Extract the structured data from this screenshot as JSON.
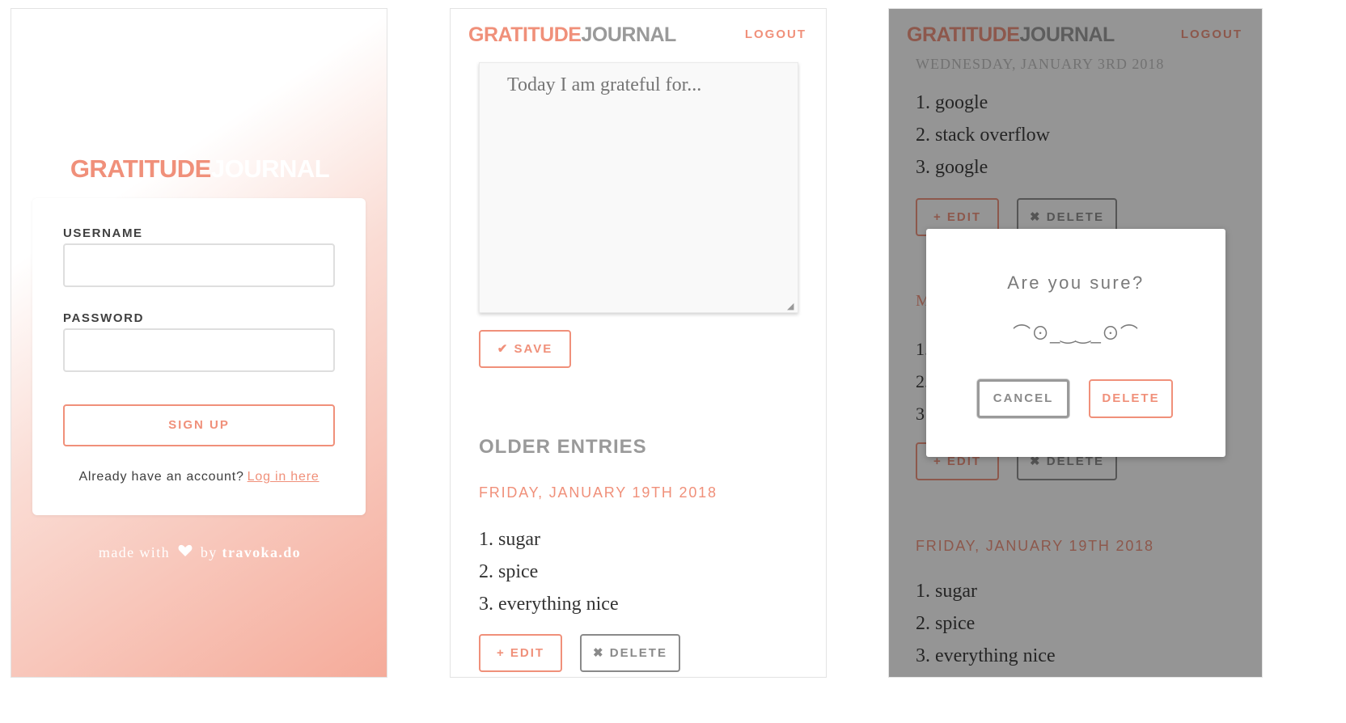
{
  "app": {
    "brand_part1": "GRATITUDE",
    "brand_part2": "JOURNAL"
  },
  "login": {
    "username_label": "USERNAME",
    "password_label": "PASSWORD",
    "signup_label": "SIGN UP",
    "account_prompt": "Already have an account?",
    "login_link": "Log in here",
    "footer_made_with": "made with",
    "footer_heart": "heart-icon",
    "footer_by": "by",
    "footer_author": "travoka.do"
  },
  "header": {
    "logout_label": "LOGOUT"
  },
  "journal": {
    "textarea_placeholder": "Today I am grateful for...",
    "save_icon": "✔",
    "save_label": "SAVE",
    "older_entries_title": "OLDER ENTRIES",
    "entry": {
      "date": "FRIDAY, JANUARY 19TH 2018",
      "items": [
        "1. sugar",
        "2. spice",
        "3. everything nice"
      ]
    },
    "edit_icon": "+",
    "edit_label": "EDIT",
    "delete_icon": "✖",
    "delete_label": "DELETE"
  },
  "confirm_view": {
    "top_entry_partial_date": "WEDNESDAY, JANUARY 3RD 2018",
    "top_entry_items": [
      "1. google",
      "2. stack overflow",
      "3. google"
    ],
    "middle_partial_letters": [
      "M",
      "1.",
      "2.",
      "3"
    ],
    "bottom_entry": {
      "date": "FRIDAY, JANUARY 19TH 2018",
      "items": [
        "1. sugar",
        "2. spice",
        "3. everything nice"
      ]
    },
    "modal": {
      "title": "Are you sure?",
      "face": "⌒⊙_‿‿_⊙⌒",
      "cancel_label": "CANCEL",
      "delete_label": "DELETE"
    }
  },
  "colors": {
    "accent": "#f0907a",
    "muted": "#9a9a9a",
    "overlay": "rgba(20,20,20,0.45)"
  }
}
